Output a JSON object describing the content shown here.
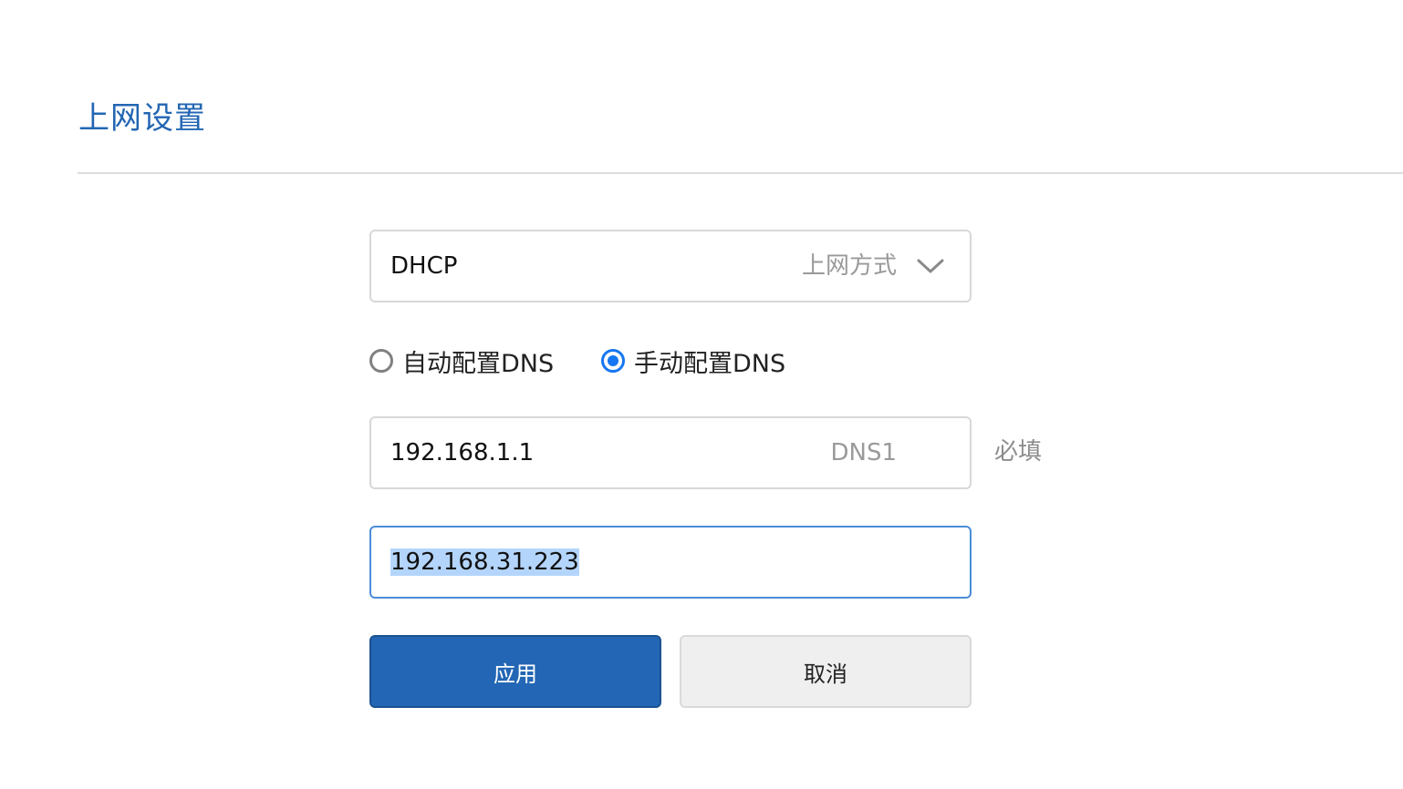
{
  "page": {
    "title": "上网设置"
  },
  "connection": {
    "mode_value": "DHCP",
    "mode_label": "上网方式"
  },
  "dns_mode": {
    "options": [
      {
        "label": "自动配置DNS",
        "checked": false
      },
      {
        "label": "手动配置DNS",
        "checked": true
      }
    ]
  },
  "dns1": {
    "value": "192.168.1.1",
    "label": "DNS1",
    "required_note": "必填"
  },
  "dns2": {
    "value": "192.168.31.223"
  },
  "actions": {
    "apply_label": "应用",
    "cancel_label": "取消"
  },
  "colors": {
    "accent": "#2366b3",
    "radio_checked": "#1677f2",
    "selection": "#b4d5fb"
  }
}
